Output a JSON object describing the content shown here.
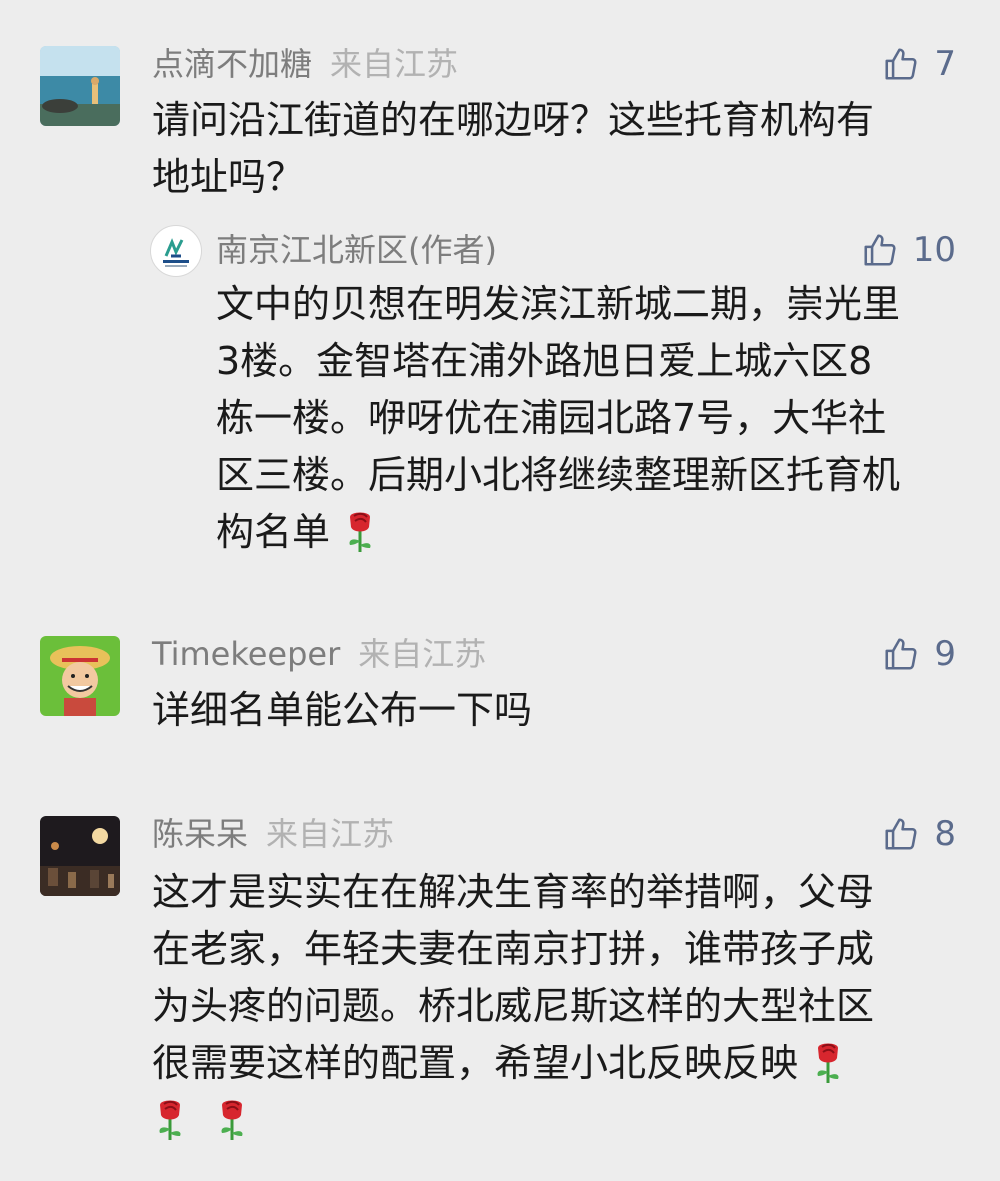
{
  "comments": [
    {
      "nickname": "点滴不加糖",
      "location": "来自江苏",
      "likes": "7",
      "lines": [
        "请问沿江街道的在哪边呀？这些托育机构有",
        "地址吗？"
      ],
      "reply": {
        "nickname": "南京江北新区(作者)",
        "likes": "10",
        "lines": [
          "文中的贝想在明发滨江新城二期，崇光里",
          "3楼。金智塔在浦外路旭日爱上城六区8",
          "栋一楼。咿呀优在浦园北路7号，大华社",
          "区三楼。后期小北将继续整理新区托育机",
          "构名单"
        ]
      }
    },
    {
      "nickname": "Timekeeper",
      "location": "来自江苏",
      "likes": "9",
      "lines": [
        "详细名单能公布一下吗"
      ]
    },
    {
      "nickname": "陈呆呆",
      "location": "来自江苏",
      "likes": "8",
      "lines": [
        "这才是实实在在解决生育率的举措啊，父母",
        "在老家，年轻夫妻在南京打拼，谁带孩子成",
        "为头疼的问题。桥北威尼斯这样的大型社区",
        "很需要这样的配置，希望小北反映反映"
      ]
    }
  ],
  "icons": {
    "like": "thumbs-up-icon",
    "emoji": "rose-emoji-icon"
  },
  "colors": {
    "background": "#ededed",
    "nickname": "#7d7d7d",
    "location": "#b2b2b2",
    "like_icon": "#5b6b8c",
    "text": "#1a1a1a"
  }
}
